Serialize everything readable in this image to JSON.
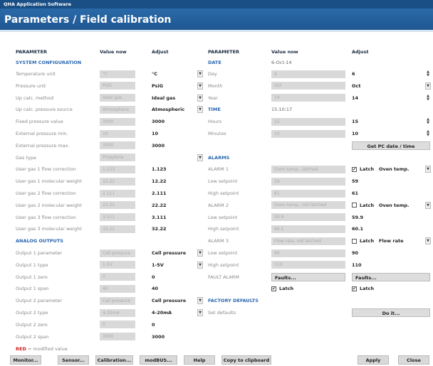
{
  "app_title": "QHA Application Software",
  "page_title": "Parameters / Field calibration",
  "headers": {
    "parameter": "PARAMETER",
    "value_now": "Value now",
    "adjust": "Adjust"
  },
  "left": {
    "system_config_title": "SYSTEM CONFIGURATION",
    "system_rows": [
      {
        "label": "Temperature unit",
        "value": "°C",
        "adjust": "°C",
        "dropdown": true
      },
      {
        "label": "Pressure unit",
        "value": "PsiG",
        "adjust": "PsiG",
        "dropdown": true
      },
      {
        "label": "Up calc. method",
        "value": "Ideal gas",
        "adjust": "Ideal gas",
        "dropdown": true
      },
      {
        "label": "Up calc. pressure source",
        "value": "Atmospheric",
        "adjust": "Atmospheric",
        "dropdown": true
      },
      {
        "label": "Fixed pressure value",
        "value": "3000",
        "adjust": "3000",
        "dropdown": false
      },
      {
        "label": "External pressure min.",
        "value": "10",
        "adjust": "10",
        "dropdown": false
      },
      {
        "label": "External pressure max.",
        "value": "3000",
        "adjust": "3000",
        "dropdown": false
      },
      {
        "label": "Gas type",
        "value": "Propylene",
        "adjust": "",
        "dropdown": true
      },
      {
        "label": "User gas 1 flow correction",
        "value": "1.123",
        "adjust": "1.123",
        "dropdown": false
      },
      {
        "label": "User gas 1 molecular weight",
        "value": "12.22",
        "adjust": "12.22",
        "dropdown": false
      },
      {
        "label": "User gas 2 flow correction",
        "value": "2.111",
        "adjust": "2.111",
        "dropdown": false
      },
      {
        "label": "User gas 2 molecular weight",
        "value": "22.22",
        "adjust": "22.22",
        "dropdown": false
      },
      {
        "label": "User gas 3 flow correction",
        "value": "3.111",
        "adjust": "3.111",
        "dropdown": false
      },
      {
        "label": "User gas 3 molecular weight",
        "value": "32.22",
        "adjust": "32.22",
        "dropdown": false
      }
    ],
    "analog_title": "ANALOG OUTPUTS",
    "analog_rows": [
      {
        "label": "Output 1 parameter",
        "value": "Cell pressure",
        "adjust": "Cell pressure",
        "dropdown": true
      },
      {
        "label": "Output 1 type",
        "value": "1-5V",
        "adjust": "1-5V",
        "dropdown": true
      },
      {
        "label": "Output 1 zero",
        "value": "0",
        "adjust": "0",
        "dropdown": false
      },
      {
        "label": "Output 1 span",
        "value": "40",
        "adjust": "40",
        "dropdown": false
      },
      {
        "label": "Output 2 parameter",
        "value": "Cell pressure",
        "adjust": "Cell pressure",
        "dropdown": true
      },
      {
        "label": "Output 2 type",
        "value": "4-20mA",
        "adjust": "4-20mA",
        "dropdown": true
      },
      {
        "label": "Output 2 zero",
        "value": "0",
        "adjust": "0",
        "dropdown": false
      },
      {
        "label": "Output 2 span",
        "value": "3000",
        "adjust": "3000",
        "dropdown": false
      }
    ]
  },
  "right": {
    "date_title": "DATE",
    "date_value": "6-Oct-14",
    "date_rows": [
      {
        "label": "Day",
        "value": "6",
        "adjust": "6",
        "control": "spin"
      },
      {
        "label": "Month",
        "value": "Oct",
        "adjust": "Oct",
        "control": "dropdown"
      },
      {
        "label": "Year",
        "value": "14",
        "adjust": "14",
        "control": "spin"
      }
    ],
    "time_title": "TIME",
    "time_value": "15:10:17",
    "time_rows": [
      {
        "label": "Hours",
        "value": "15",
        "adjust": "15",
        "control": "spin"
      },
      {
        "label": "Minutes",
        "value": "10",
        "adjust": "10",
        "control": "spin"
      }
    ],
    "get_pc_date": "Get PC date / time",
    "alarms_title": "ALARMS",
    "alarm1": {
      "label": "ALARM 1",
      "value": "Oven temp., latched",
      "latch": "Latch",
      "latch_checked": true,
      "param": "Oven temp."
    },
    "alarm1_low": {
      "label": "Low setpoint",
      "value": "59",
      "adjust": "59"
    },
    "alarm1_high": {
      "label": "High setpoint",
      "value": "61",
      "adjust": "61"
    },
    "alarm2": {
      "label": "ALARM 2",
      "value": "Oven temp., not latched",
      "latch": "Latch",
      "latch_checked": false,
      "param": "Oven temp."
    },
    "alarm2_low": {
      "label": "Low setpoint",
      "value": "59.9",
      "adjust": "59.9"
    },
    "alarm2_high": {
      "label": "High setpoint",
      "value": "60.1",
      "adjust": "60.1"
    },
    "alarm3": {
      "label": "ALARM 3",
      "value": "Flow rate, not latched",
      "latch": "Latch",
      "latch_checked": false,
      "param": "Flow rate"
    },
    "alarm3_low": {
      "label": "Low setpoint",
      "value": "90",
      "adjust": "90"
    },
    "alarm3_high": {
      "label": "High setpoint",
      "value": "110",
      "adjust": "110"
    },
    "fault": {
      "label": "FAULT ALARM",
      "faults_now": "Faults...",
      "faults_adj": "Faults...",
      "latch": "Latch"
    },
    "factory_title": "FACTORY DEFAULTS",
    "set_defaults": "Set defaults",
    "do_it": "Do it..."
  },
  "legend": {
    "red": "RED",
    "text": "= modified value"
  },
  "bottom_buttons": [
    "Monitor...",
    "Sensor...",
    "Calibration...",
    "modBUS...",
    "Help",
    "Copy to clipboard"
  ],
  "apply": "Apply",
  "close": "Close",
  "colors": {
    "title_bar": "#1e5590",
    "section_title": "#2a66b0",
    "value_box": "#d9d9d9",
    "modified": "#d02020"
  }
}
